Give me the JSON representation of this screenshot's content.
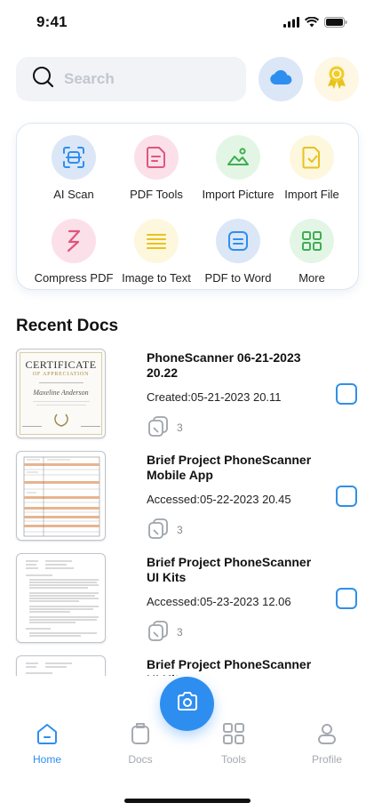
{
  "status_bar": {
    "time": "9:41"
  },
  "search": {
    "placeholder": "Search"
  },
  "header_buttons": {
    "cloud_icon": "cloud-icon",
    "award_icon": "award-icon"
  },
  "tools": [
    {
      "label": "AI Scan",
      "icon": "ai-scan-icon",
      "bg": "#dbe7f7",
      "color": "#2e8ef0"
    },
    {
      "label": "PDF Tools",
      "icon": "pdf-tools-icon",
      "bg": "#fbe0ea",
      "color": "#e0567d"
    },
    {
      "label": "Import Picture",
      "icon": "image-icon",
      "bg": "#e3f6e6",
      "color": "#3fae52"
    },
    {
      "label": "Import File",
      "icon": "file-icon",
      "bg": "#fdf7de",
      "color": "#e9c21e"
    },
    {
      "label": "Compress PDF",
      "icon": "compress-icon",
      "bg": "#fbe0ea",
      "color": "#e0567d"
    },
    {
      "label": "Image to Text",
      "icon": "text-lines-icon",
      "bg": "#fdf7de",
      "color": "#e9c21e"
    },
    {
      "label": "PDF to Word",
      "icon": "word-icon",
      "bg": "#dbe7f7",
      "color": "#2e8ef0"
    },
    {
      "label": "More",
      "icon": "grid-icon",
      "bg": "#e3f6e6",
      "color": "#3fae52"
    }
  ],
  "recent": {
    "title": "Recent Docs",
    "docs": [
      {
        "title": "PhoneScanner 06-21-2023 20.22",
        "meta": "Created:05-21-2023 20.11",
        "pages": "3",
        "thumb": "certificate"
      },
      {
        "title": "Brief Project PhoneScanner Mobile App",
        "meta": "Accessed:05-22-2023 20.45",
        "pages": "3",
        "thumb": "table"
      },
      {
        "title": "Brief Project PhoneScanner UI Kits",
        "meta": "Accessed:05-23-2023 12.06",
        "pages": "3",
        "thumb": "document"
      },
      {
        "title": "Brief Project PhoneScanner UI Kits",
        "meta": "",
        "pages": "",
        "thumb": "document"
      }
    ],
    "certificate_thumb": {
      "heading": "CERTIFICATE",
      "subheading": "OF APPRECIATION",
      "name": "Maxeline Anderson"
    }
  },
  "nav": {
    "items": [
      {
        "label": "Home",
        "icon": "home-icon"
      },
      {
        "label": "Docs",
        "icon": "docs-icon"
      },
      {
        "label": "Tools",
        "icon": "tools-icon"
      },
      {
        "label": "Profile",
        "icon": "profile-icon"
      }
    ],
    "active": "Home",
    "fab_icon": "camera-icon"
  },
  "colors": {
    "accent": "#2e8ef0",
    "text": "#111111",
    "muted": "#a5a9b0"
  }
}
